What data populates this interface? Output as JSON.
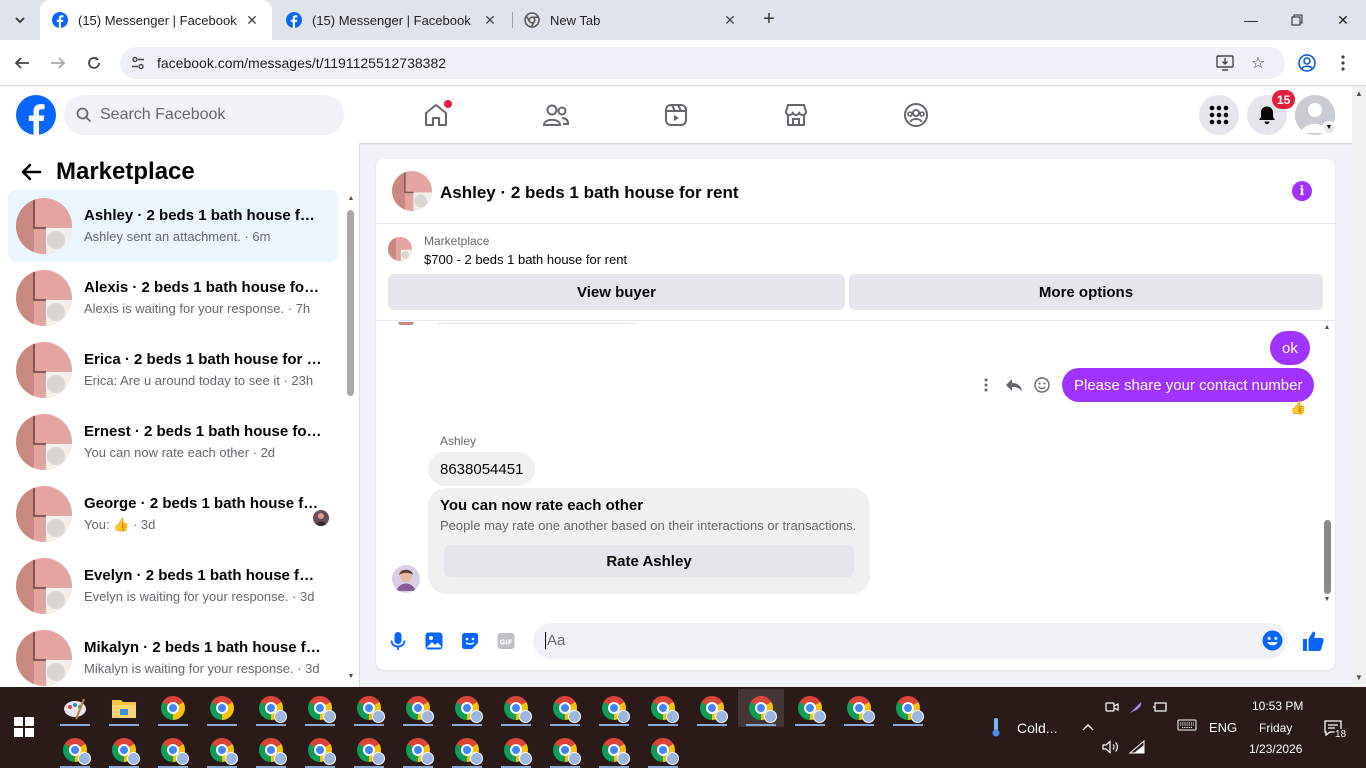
{
  "browser": {
    "tabs": [
      {
        "title": "(15) Messenger | Facebook",
        "active": true
      },
      {
        "title": "(15) Messenger | Facebook",
        "active": false
      },
      {
        "title": "New Tab",
        "active": false
      }
    ],
    "url": "facebook.com/messages/t/1191125512738382"
  },
  "fb_nav": {
    "search_placeholder": "Search Facebook",
    "notification_count": "15",
    "brand_color": "#0866ff"
  },
  "left_panel": {
    "title": "Marketplace",
    "conversations": [
      {
        "title": "Ashley · 2 beds 1 bath house for rent",
        "subtitle": "Ashley sent an attachment. · 6m",
        "active": true
      },
      {
        "title": "Alexis · 2 beds 1 bath house for rent",
        "subtitle": "Alexis is waiting for your response. · 7h"
      },
      {
        "title": "Erica · 2 beds 1 bath house for rent",
        "subtitle": "Erica: Are u around today to see it · 23h"
      },
      {
        "title": "Ernest · 2 beds 1 bath house for rent",
        "subtitle": "You can now rate each other · 2d"
      },
      {
        "title": "George · 2 beds 1 bath house for rent",
        "subtitle": "You: 👍 · 3d"
      },
      {
        "title": "Evelyn · 2 beds 1 bath house for rent",
        "subtitle": "Evelyn is waiting for your response. · 3d"
      },
      {
        "title": "Mikalyn · 2 beds 1 bath house for rent",
        "subtitle": "Mikalyn is waiting for your response. · 3d"
      }
    ]
  },
  "chat": {
    "header_title": "Ashley · 2 beds 1 bath house for rent",
    "marketplace_label": "Marketplace",
    "listing": "$700 - 2 beds 1 bath house for rent",
    "view_buyer": "View buyer",
    "more_options": "More options",
    "messages": {
      "out_1": "ok",
      "out_2": "Please share your contact number",
      "reaction": "👍",
      "sender_name": "Ashley",
      "in_1": "8638054451"
    },
    "rate_card": {
      "title": "You can now rate each other",
      "subtitle": "People may rate one another based on their interactions or transactions.",
      "button": "Rate Ashley"
    },
    "composer_placeholder": "Aa",
    "accent_color": "#a033ff"
  },
  "taskbar": {
    "weather": "Cold...",
    "language": "ENG",
    "time": "10:53 PM",
    "day": "Friday",
    "date": "1/23/2026",
    "notification_count": "18"
  }
}
